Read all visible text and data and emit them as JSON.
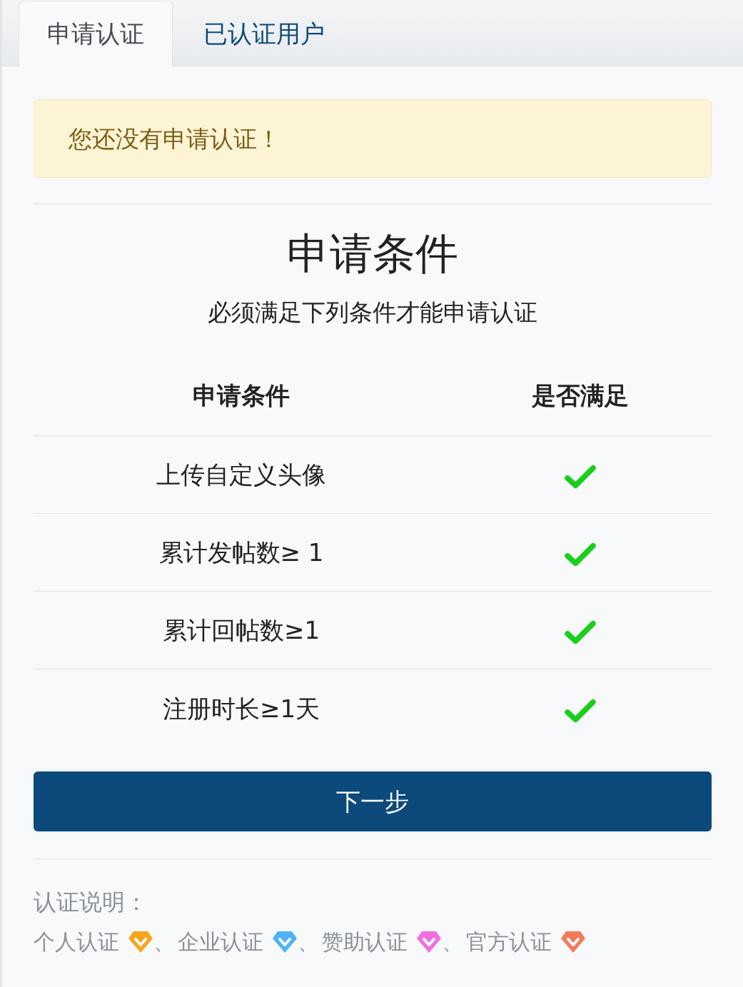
{
  "tabs": [
    {
      "label": "申请认证",
      "selected": true
    },
    {
      "label": "已认证用户",
      "selected": false
    }
  ],
  "alert": {
    "message": "您还没有申请认证！"
  },
  "conditions": {
    "title": "申请条件",
    "subtitle": "必须满足下列条件才能申请认证",
    "columns": [
      "申请条件",
      "是否满足"
    ],
    "rows": [
      {
        "condition": "上传自定义头像",
        "met": true
      },
      {
        "condition": "累计发帖数≥ 1",
        "met": true
      },
      {
        "condition": "累计回帖数≥1",
        "met": true
      },
      {
        "condition": "注册时长≥1天",
        "met": true
      }
    ]
  },
  "next_button": {
    "label": "下一步"
  },
  "notes": {
    "heading": "认证说明：",
    "badges": [
      {
        "label": "个人认证",
        "color": "#f7a51c",
        "separator": "、"
      },
      {
        "label": "企业认证",
        "color": "#4db2f6",
        "separator": "、"
      },
      {
        "label": "赞助认证",
        "color": "#ef6fe0",
        "separator": "、"
      },
      {
        "label": "官方认证",
        "color": "#f27b5b"
      }
    ]
  }
}
